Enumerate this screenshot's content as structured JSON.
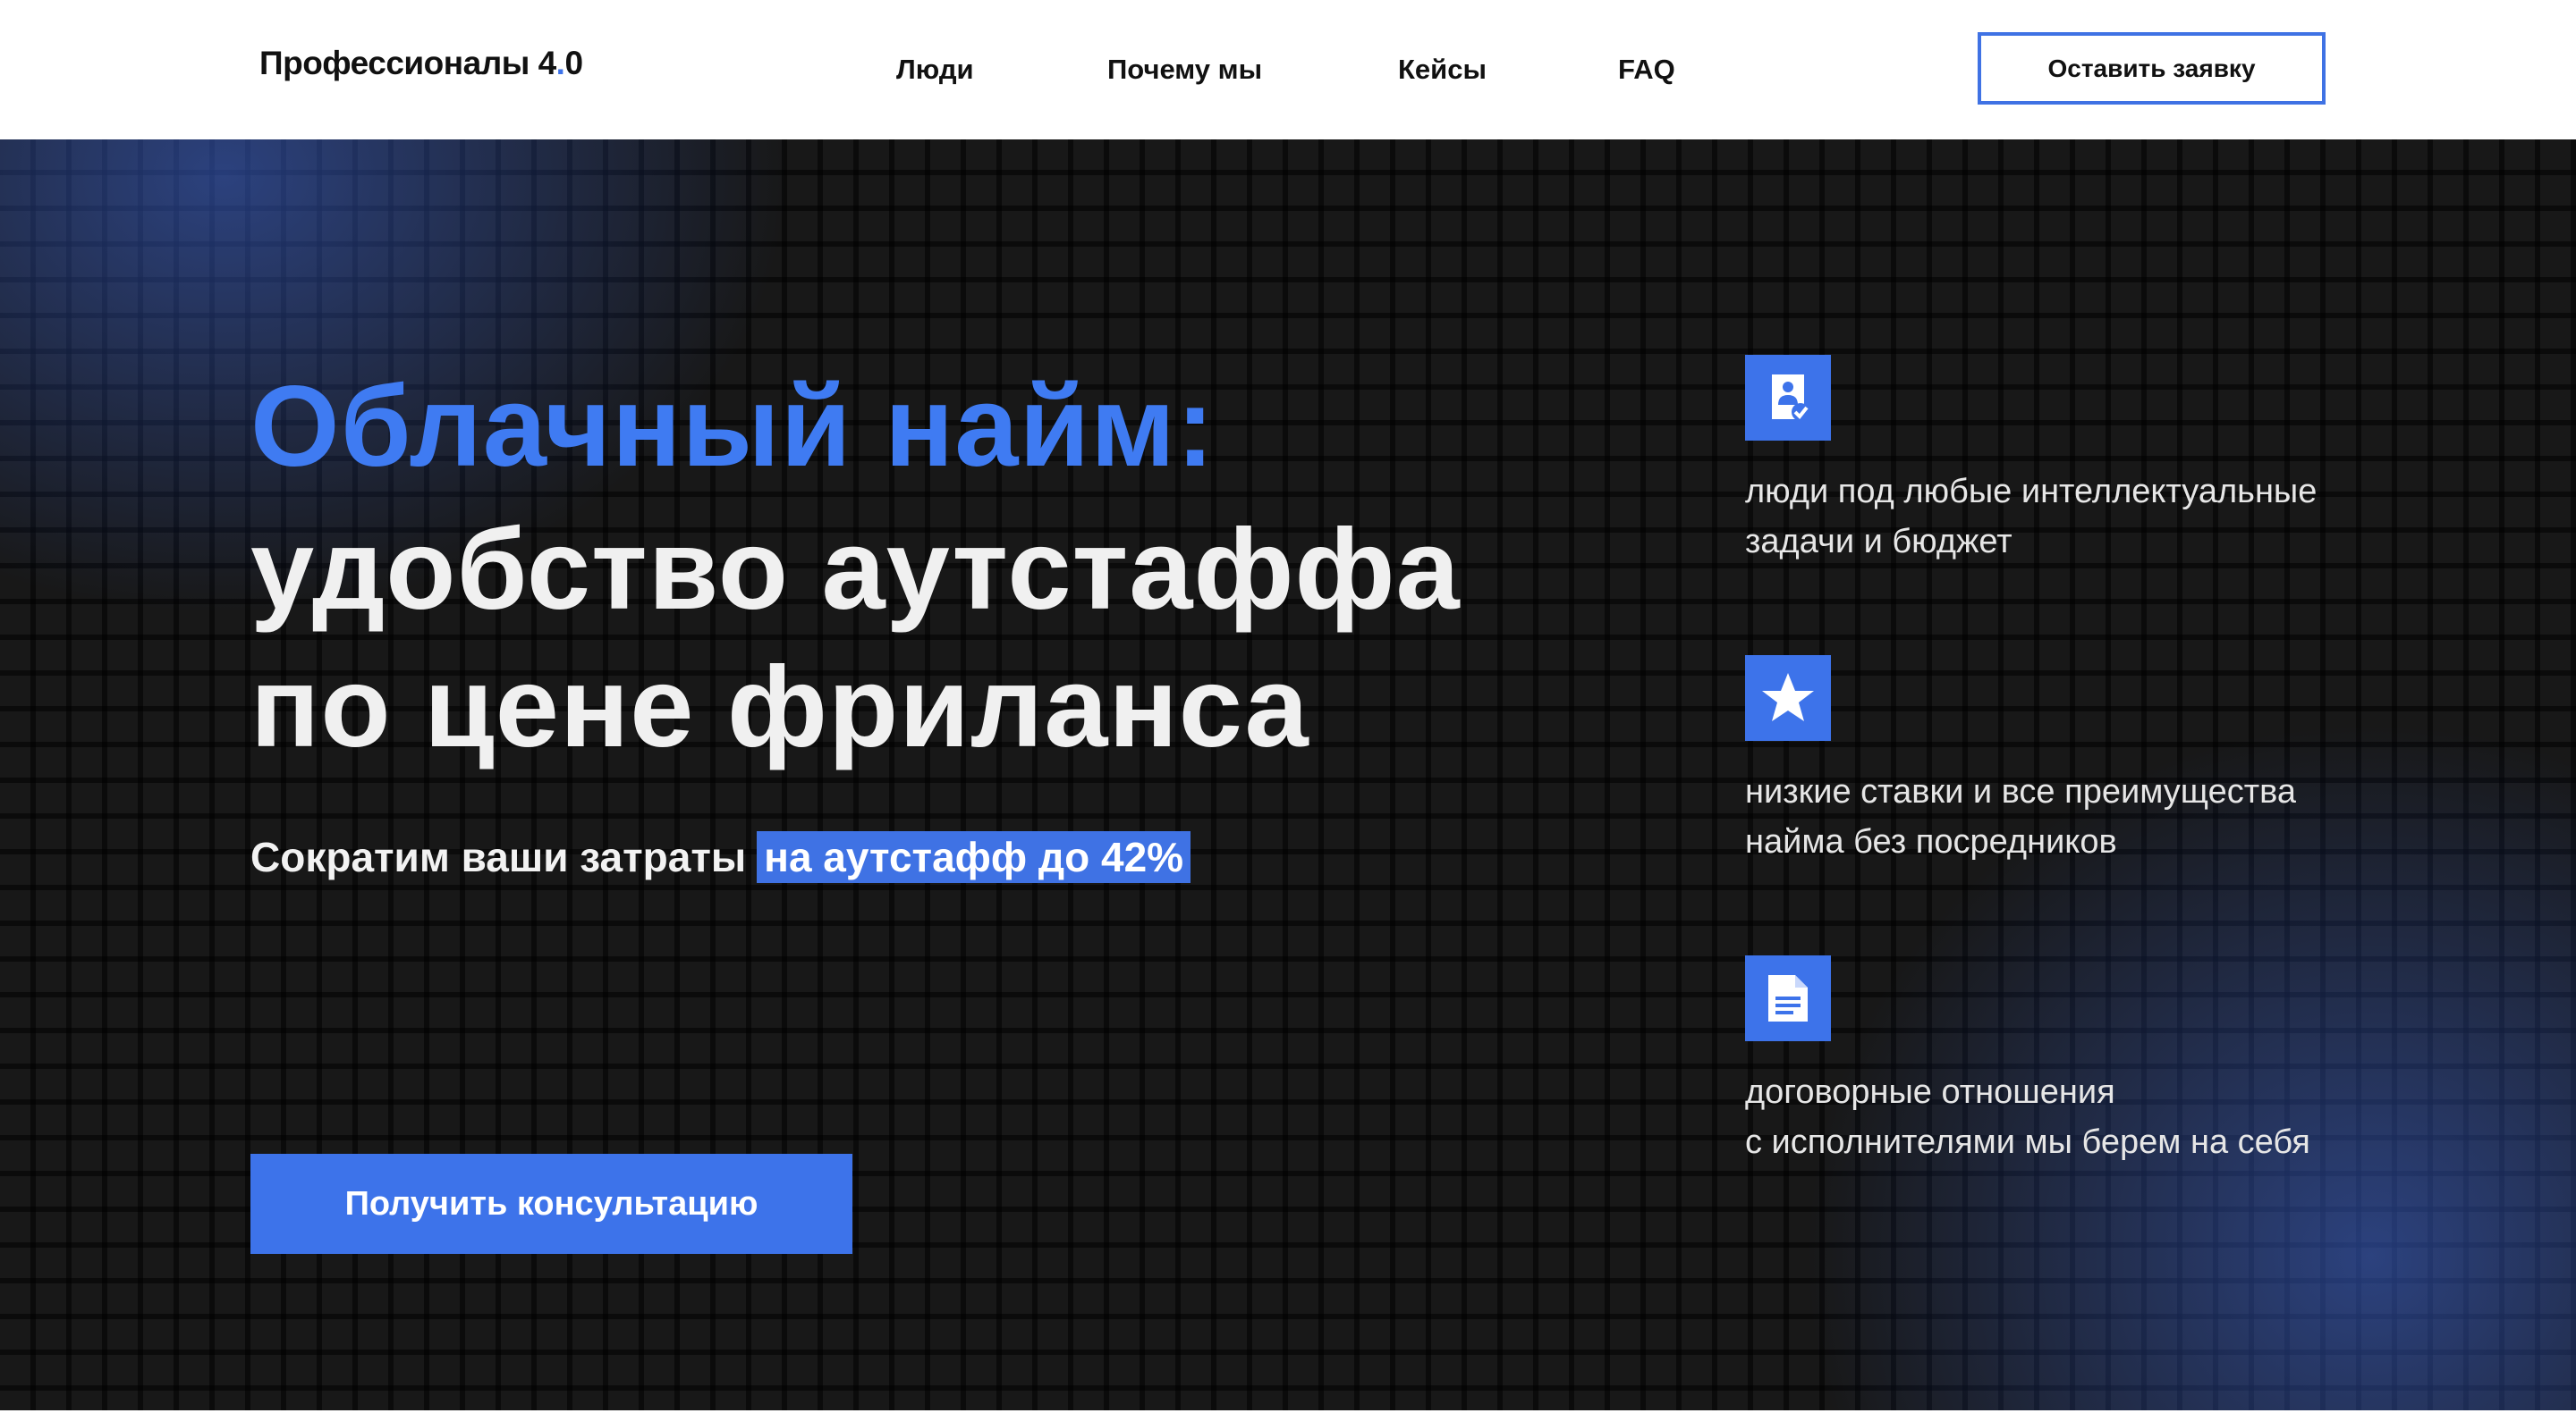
{
  "header": {
    "logo_text": "Профессионалы 4",
    "logo_dot": ".",
    "logo_suffix": "0",
    "nav": [
      "Люди",
      "Почему мы",
      "Кейсы",
      "FAQ"
    ],
    "cta_label": "Оставить заявку"
  },
  "hero": {
    "title_blue": "Облачный найм:",
    "title_line2": "удобство аутстаффа",
    "title_line3": "по цене фриланса",
    "subtitle": "Сократим ваши затраты",
    "subtitle_highlight": "на аутстафф до 42%",
    "button_label": "Получить консультацию"
  },
  "features": [
    {
      "icon": "person-check-icon",
      "line1": "люди под любые интеллектуальные",
      "line2": "задачи и бюджет"
    },
    {
      "icon": "star-icon",
      "line1": "низкие ставки и все преимущества",
      "line2": "найма без посредников"
    },
    {
      "icon": "document-icon",
      "line1": "договорные отношения",
      "line2": "с исполнителями мы берем на себя"
    }
  ],
  "colors": {
    "accent": "#3d73ea",
    "title_blue": "#3f7bf2",
    "background": "#181818"
  }
}
